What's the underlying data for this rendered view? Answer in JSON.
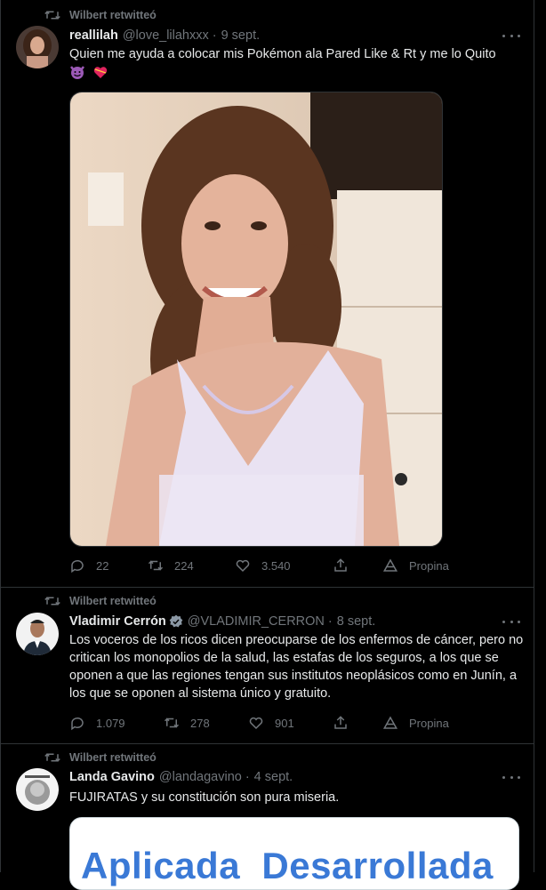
{
  "colors": {
    "background": "#000000",
    "muted": "#71767b",
    "text": "#e7e9ea",
    "border": "#2f3336",
    "verified": "#8b98a5"
  },
  "tweets": [
    {
      "retweet_label": "Wilbert retwitteó",
      "name": "reallilah",
      "handle": "@love_lilahxxx",
      "date": "9 sept.",
      "text": "Quien me ayuda a colocar mis Pokémon ala Pared Like & Rt y me lo Quito",
      "emojis": [
        "smiling-devil-emoji",
        "heart-emoji"
      ],
      "media": "photo",
      "actions": {
        "replies": "22",
        "retweets": "224",
        "likes": "3.540",
        "share_label": "",
        "promote_label": "Propina"
      }
    },
    {
      "retweet_label": "Wilbert retwitteó",
      "name": "Vladimir Cerrón",
      "verified": true,
      "handle": "@VLADIMIR_CERRON",
      "date": "8 sept.",
      "text": "Los voceros de los ricos dicen preocuparse de los enfermos de cáncer, pero no critican los monopolios de la salud, las estafas de los seguros, a los que se oponen a que las regiones tengan sus institutos neoplásicos como en Junín, a los que se oponen al sistema único y gratuito.",
      "actions": {
        "replies": "1.079",
        "retweets": "278",
        "likes": "901",
        "promote_label": "Propina"
      }
    },
    {
      "retweet_label": "Wilbert retwitteó",
      "name": "Landa Gavino",
      "handle": "@landagavino",
      "date": "4 sept.",
      "text": "FUJIRATAS y su constitución son pura miseria.",
      "media_text": "Aplicada  Desarrollada"
    }
  ]
}
